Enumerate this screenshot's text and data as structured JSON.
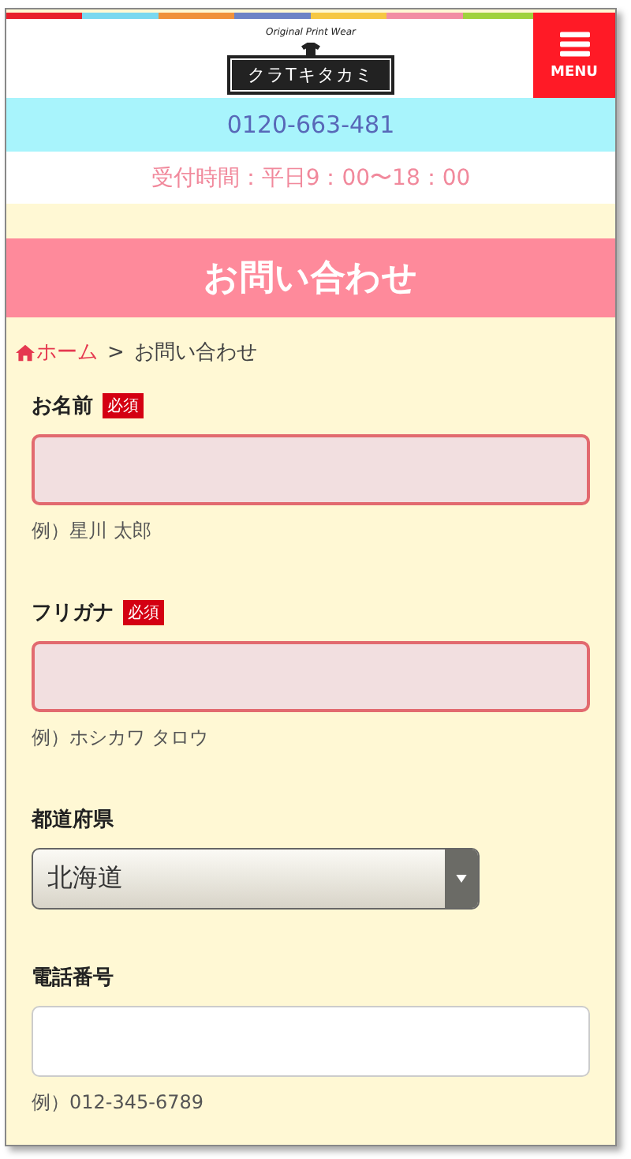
{
  "header": {
    "logo": {
      "tagline": "Original Print Wear",
      "name": "クラTキタカミ"
    },
    "menu_button": "MENU"
  },
  "phone": "0120-663-481",
  "hours": "受付時間：平日9：00〜18：00",
  "page_title": "お問い合わせ",
  "breadcrumb": [
    {
      "label": "ホーム",
      "kind": "home"
    },
    {
      "label": ">",
      "kind": "separator"
    },
    {
      "label": "お問い合わせ",
      "kind": "current"
    }
  ],
  "form": {
    "fields": [
      {
        "kind": "text",
        "label": "お名前",
        "required": true,
        "badge": "必須",
        "invalid": true,
        "hint": "例）星川 太郎"
      },
      {
        "kind": "text",
        "label": "フリガナ",
        "required": true,
        "badge": "必須",
        "invalid": true,
        "hint": "例）ホシカワ タロウ"
      },
      {
        "kind": "select",
        "label": "都道府県",
        "required": false,
        "value": "北海道"
      },
      {
        "kind": "text",
        "label": "電話番号",
        "required": false,
        "invalid": false,
        "hint": "例）012-345-6789"
      }
    ]
  }
}
